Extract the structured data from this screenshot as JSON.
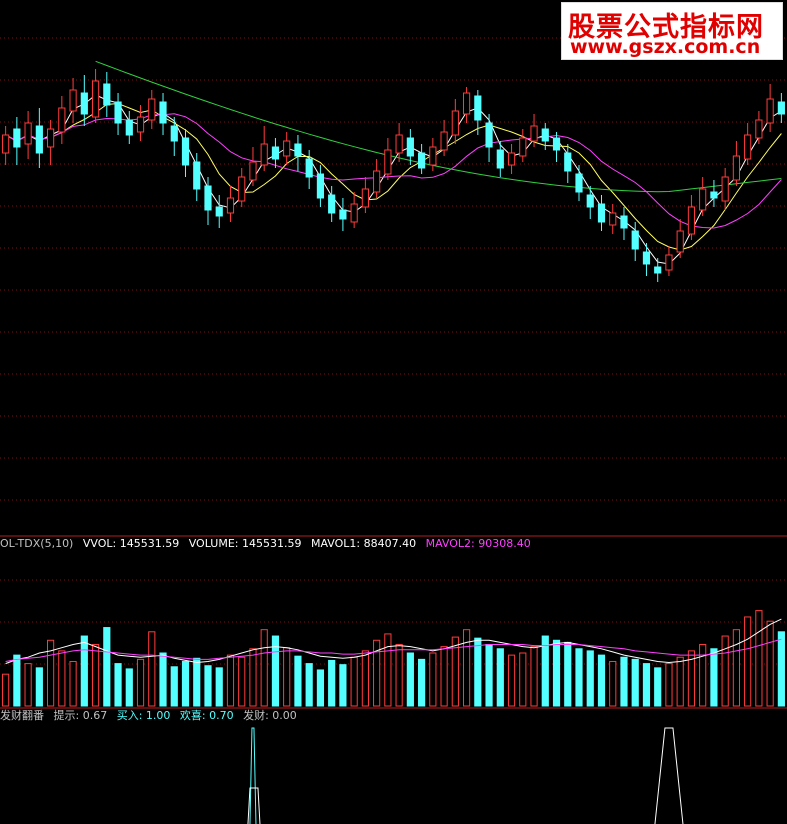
{
  "colors": {
    "background": "#000000",
    "up_candle": "#ff3c3c",
    "down_candle": "#54ffff",
    "ma_white": "#ffffff",
    "ma_yellow": "#ffff64",
    "ma_magenta": "#ff40ff",
    "ma_green": "#30d040",
    "grid": "#7a1212",
    "separator": "#b01e1e"
  },
  "watermark": {
    "line1": "股票公式指标网",
    "line2": "www.gszx.com.cn"
  },
  "volume_header": {
    "name": "OL-TDX(5,10)",
    "vvol": "VVOL: 145531.59",
    "volume": "VOLUME: 145531.59",
    "mavol1": "MAVOL1: 88407.40",
    "mavol2": "MAVOL2: 90308.40"
  },
  "indicator_header": {
    "name": "发财翻番",
    "tishi": "提示: 0.67",
    "mairu": "买入: 1.00",
    "huanxi": "欢喜: 0.70",
    "facai": "发财: 0.00"
  },
  "chart_data": [
    {
      "type": "candlestick",
      "description_ma": [
        "short MA (white)",
        "medium MA (yellow)",
        "MA (magenta)",
        "long MA (green)"
      ],
      "candles": [
        [
          94,
          100,
          90,
          103
        ],
        [
          102,
          96,
          90,
          106
        ],
        [
          97,
          104,
          92,
          108
        ],
        [
          103,
          94,
          89,
          109
        ],
        [
          96,
          102,
          90,
          105
        ],
        [
          101,
          109,
          97,
          113
        ],
        [
          108,
          115,
          104,
          119
        ],
        [
          114,
          107,
          103,
          120
        ],
        [
          106,
          118,
          104,
          122
        ],
        [
          117,
          110,
          106,
          121
        ],
        [
          111,
          104,
          100,
          114
        ],
        [
          105,
          100,
          97,
          108
        ],
        [
          101,
          106,
          98,
          110
        ],
        [
          105,
          112,
          102,
          115
        ],
        [
          111,
          104,
          100,
          114
        ],
        [
          103,
          98,
          93,
          106
        ],
        [
          99,
          90,
          86,
          102
        ],
        [
          91,
          82,
          78,
          94
        ],
        [
          83,
          75,
          70,
          86
        ],
        [
          76,
          73,
          69,
          80
        ],
        [
          74,
          79,
          71,
          83
        ],
        [
          78,
          86,
          76,
          89
        ],
        [
          85,
          91,
          83,
          96
        ],
        [
          90,
          97,
          88,
          103
        ],
        [
          96,
          92,
          89,
          99
        ],
        [
          93,
          98,
          90,
          101
        ],
        [
          97,
          93,
          88,
          100
        ],
        [
          92,
          86,
          82,
          95
        ],
        [
          87,
          79,
          76,
          90
        ],
        [
          80,
          74,
          71,
          83
        ],
        [
          75,
          72,
          68,
          79
        ],
        [
          71,
          77,
          69,
          81
        ],
        [
          76,
          82,
          74,
          86
        ],
        [
          81,
          88,
          79,
          92
        ],
        [
          87,
          95,
          85,
          99
        ],
        [
          94,
          100,
          91,
          104
        ],
        [
          99,
          93,
          90,
          102
        ],
        [
          94,
          89,
          87,
          97
        ],
        [
          90,
          96,
          88,
          99
        ],
        [
          95,
          101,
          93,
          105
        ],
        [
          100,
          108,
          97,
          112
        ],
        [
          107,
          114,
          104,
          116
        ],
        [
          113,
          105,
          100,
          115
        ],
        [
          104,
          96,
          91,
          107
        ],
        [
          95,
          89,
          86,
          98
        ],
        [
          90,
          94,
          87,
          97
        ],
        [
          93,
          99,
          91,
          102
        ],
        [
          98,
          103,
          96,
          107
        ],
        [
          102,
          98,
          95,
          104
        ],
        [
          99,
          95,
          91,
          101
        ],
        [
          94,
          88,
          84,
          97
        ],
        [
          87,
          81,
          78,
          90
        ],
        [
          80,
          76,
          72,
          83
        ],
        [
          77,
          71,
          68,
          80
        ],
        [
          70,
          74,
          67,
          77
        ],
        [
          73,
          69,
          65,
          76
        ],
        [
          68,
          62,
          58,
          71
        ],
        [
          61,
          57,
          53,
          64
        ],
        [
          56,
          54,
          51,
          59
        ],
        [
          55,
          60,
          53,
          63
        ],
        [
          61,
          68,
          59,
          72
        ],
        [
          67,
          76,
          65,
          80
        ],
        [
          75,
          82,
          73,
          86
        ],
        [
          81,
          79,
          76,
          85
        ],
        [
          78,
          86,
          75,
          89
        ],
        [
          85,
          93,
          83,
          98
        ],
        [
          92,
          100,
          90,
          104
        ],
        [
          99,
          105,
          97,
          108
        ],
        [
          104,
          112,
          101,
          117
        ],
        [
          111,
          107,
          104,
          114
        ]
      ],
      "volumes": [
        30,
        48,
        40,
        36,
        62,
        52,
        42,
        66,
        58,
        74,
        40,
        35,
        44,
        70,
        50,
        37,
        42,
        45,
        38,
        36,
        48,
        46,
        54,
        72,
        66,
        55,
        47,
        40,
        34,
        43,
        39,
        46,
        52,
        62,
        68,
        58,
        50,
        44,
        50,
        56,
        65,
        72,
        64,
        58,
        54,
        48,
        50,
        56,
        66,
        62,
        60,
        54,
        52,
        48,
        42,
        46,
        44,
        40,
        36,
        40,
        46,
        52,
        58,
        54,
        66,
        72,
        84,
        90,
        80,
        70
      ],
      "mavol1": [
        40,
        44,
        46,
        50,
        52,
        55,
        58,
        60,
        56,
        52,
        48,
        47,
        46,
        47,
        48,
        45,
        43,
        41,
        42,
        44,
        47,
        50,
        53,
        55,
        56,
        55,
        53,
        50,
        47,
        46,
        45,
        46,
        48,
        52,
        56,
        57,
        56,
        54,
        52,
        54,
        57,
        60,
        62,
        62,
        60,
        58,
        56,
        55,
        57,
        59,
        60,
        58,
        56,
        54,
        51,
        48,
        46,
        44,
        42,
        41,
        42,
        44,
        47,
        50,
        54,
        58,
        63,
        70,
        77,
        82
      ],
      "mavol2": [
        42,
        44,
        45,
        46,
        48,
        50,
        52,
        53,
        52,
        51,
        50,
        49,
        48,
        48,
        47,
        46,
        45,
        44,
        44,
        45,
        46,
        47,
        48,
        50,
        51,
        52,
        52,
        51,
        50,
        50,
        49,
        49,
        50,
        51,
        52,
        53,
        53,
        53,
        53,
        54,
        55,
        56,
        57,
        58,
        58,
        58,
        58,
        57,
        57,
        58,
        58,
        58,
        57,
        56,
        55,
        54,
        52,
        51,
        50,
        49,
        48,
        48,
        48,
        49,
        50,
        52,
        54,
        57,
        60,
        63
      ],
      "indicator": [
        {
          "name": "peak1",
          "values": [
            0,
            0,
            0,
            0,
            0,
            0,
            0,
            0,
            0,
            0,
            0,
            0,
            0,
            0,
            0,
            0,
            0,
            0,
            0,
            0,
            0,
            0,
            0,
            0,
            0,
            0,
            0,
            0,
            0,
            0,
            0,
            0,
            0,
            0,
            0,
            0,
            0,
            0,
            0,
            0,
            0,
            0,
            0,
            0,
            0,
            0,
            0,
            0,
            0,
            0,
            0,
            0,
            0,
            0,
            0,
            0,
            0,
            0,
            0,
            0,
            0,
            0,
            0,
            0,
            0,
            0,
            0,
            0,
            0,
            0
          ]
        },
        {
          "name": "peak2",
          "values": [
            0,
            0,
            0,
            0,
            0,
            0,
            0,
            0,
            0,
            0,
            0,
            0,
            0,
            0,
            0,
            0,
            0,
            0,
            0,
            0,
            0,
            0,
            0,
            0,
            0,
            0,
            0,
            0,
            0,
            0,
            0,
            0,
            0,
            0,
            0,
            0,
            0,
            0,
            0,
            0,
            0,
            0,
            0,
            0,
            0,
            0,
            0,
            0,
            0,
            0,
            0,
            0,
            0,
            0,
            0,
            0,
            0,
            0,
            0,
            0,
            0,
            0,
            0,
            0,
            0,
            0,
            0,
            0,
            0,
            0
          ]
        }
      ],
      "indicator_peaks": [
        {
          "index": 22,
          "value": 1.0
        },
        {
          "index": 59,
          "value": 1.0
        }
      ]
    }
  ]
}
